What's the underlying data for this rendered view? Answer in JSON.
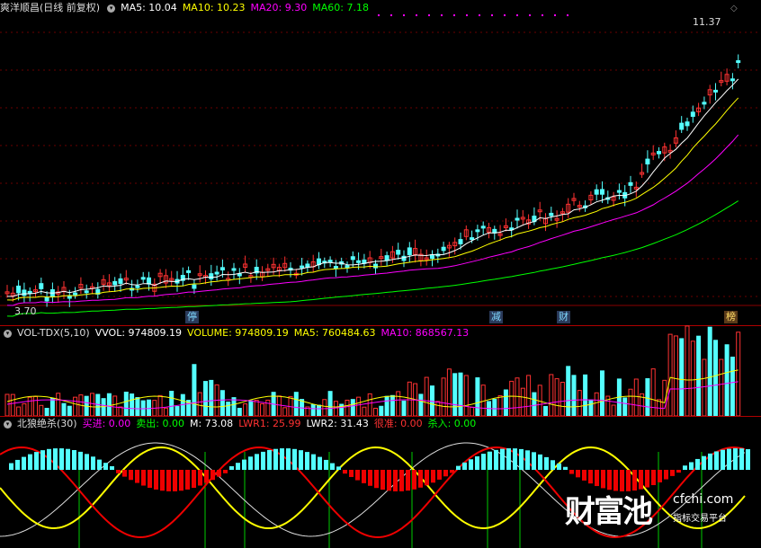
{
  "price": {
    "stock_name": "爽洋顺昌",
    "period_label": "(日线 前复权)",
    "ma5_label": "MA5: 10.04",
    "ma10_label": "MA10: 10.23",
    "ma20_label": "MA20: 9.30",
    "ma60_label": "MA60: 7.18",
    "high_marker": "11.37",
    "low_marker": "3.70",
    "event_tags": [
      "停",
      "减",
      "财",
      "榜"
    ],
    "colors": {
      "up": "#ff3232",
      "down": "#54ffff",
      "ma5": "#ffffff",
      "ma10": "#ffff00",
      "ma20": "#ff00ff",
      "ma60": "#00ff00"
    }
  },
  "volume": {
    "title": "VOL-TDX(5,10)",
    "vvol_label": "VVOL: 974809.19",
    "volume_label": "VOLUME: 974809.19",
    "ma5_label": "MA5: 760484.63",
    "ma10_label": "MA10: 868567.13"
  },
  "indicator": {
    "title": "北狼绝杀(30)",
    "buy_label": "买进: 0.00",
    "sell_label": "卖出: 0.00",
    "m_label": "M: 73.08",
    "lwr1_label": "LWR1: 25.99",
    "lwr2_label": "LWR2: 31.43",
    "accurate_label": "很准: 0.00",
    "kill_label": "杀入: 0.00"
  },
  "watermark": {
    "brand": "财富池",
    "url": "cfchi.com",
    "slogan": "指标交易平台"
  }
}
